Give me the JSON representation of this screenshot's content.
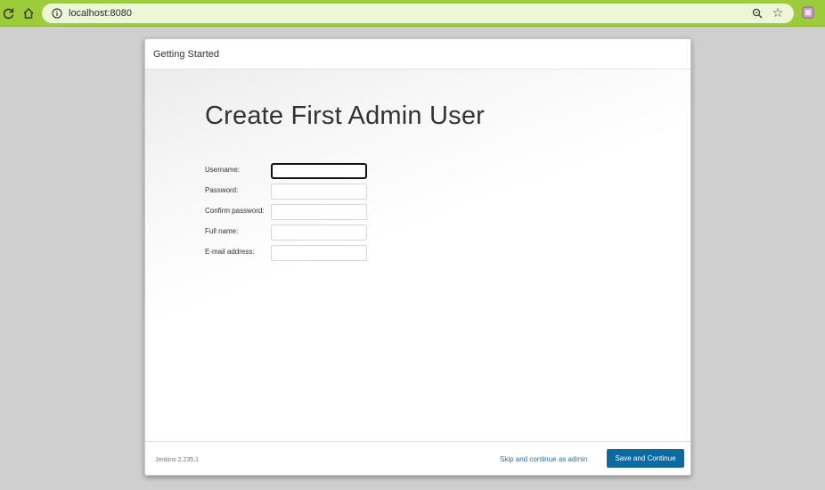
{
  "browser": {
    "url": "localhost:8080",
    "bar_color": "#9ccc3a"
  },
  "icons": {
    "reload": "reload-icon",
    "home": "home-icon",
    "info": "info-icon",
    "zoom": "zoom-icon",
    "bookmark": "star-icon",
    "extension": "extension-icon"
  },
  "dialog": {
    "header_title": "Getting Started",
    "page_title": "Create First Admin User",
    "fields": [
      {
        "label": "Username:",
        "value": "",
        "focused": true
      },
      {
        "label": "Password:",
        "value": ""
      },
      {
        "label": "Confirm password:",
        "value": ""
      },
      {
        "label": "Full name:",
        "value": ""
      },
      {
        "label": "E-mail address:",
        "value": ""
      }
    ],
    "footer": {
      "version": "Jenkins 2.235.1",
      "skip_label": "Skip and continue as admin",
      "save_label": "Save and Continue"
    },
    "colors": {
      "primary_button": "#0b6aa2",
      "link": "#2f6ea5"
    }
  }
}
